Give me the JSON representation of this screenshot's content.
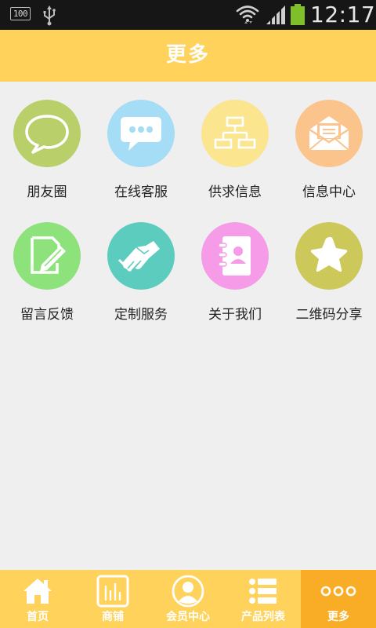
{
  "status_bar": {
    "battery_percent_text": "100",
    "time": "12:17"
  },
  "header": {
    "title": "更多"
  },
  "grid": {
    "items": [
      {
        "label": "朋友圈",
        "icon": "chat-bubble-icon",
        "color": "#b9cf69"
      },
      {
        "label": "在线客服",
        "icon": "chat-dots-icon",
        "color": "#a5dcf6"
      },
      {
        "label": "供求信息",
        "icon": "sitemap-icon",
        "color": "#fbe58f"
      },
      {
        "label": "信息中心",
        "icon": "envelope-icon",
        "color": "#fbc48d"
      },
      {
        "label": "留言反馈",
        "icon": "edit-note-icon",
        "color": "#8de27b"
      },
      {
        "label": "定制服务",
        "icon": "handshake-icon",
        "color": "#5cccbf"
      },
      {
        "label": "关于我们",
        "icon": "contacts-book-icon",
        "color": "#f59be8"
      },
      {
        "label": "二维码分享",
        "icon": "star-icon",
        "color": "#cdc85a"
      }
    ]
  },
  "bottom_nav": {
    "items": [
      {
        "label": "首页",
        "icon": "home-icon"
      },
      {
        "label": "商铺",
        "icon": "shop-icon"
      },
      {
        "label": "会员中心",
        "icon": "member-icon"
      },
      {
        "label": "产品列表",
        "icon": "list-icon"
      },
      {
        "label": "更多",
        "icon": "more-icon",
        "active": true
      }
    ]
  },
  "colors": {
    "accent": "#ffd25b",
    "active_tab": "#f9ad27",
    "background": "#efefef"
  }
}
